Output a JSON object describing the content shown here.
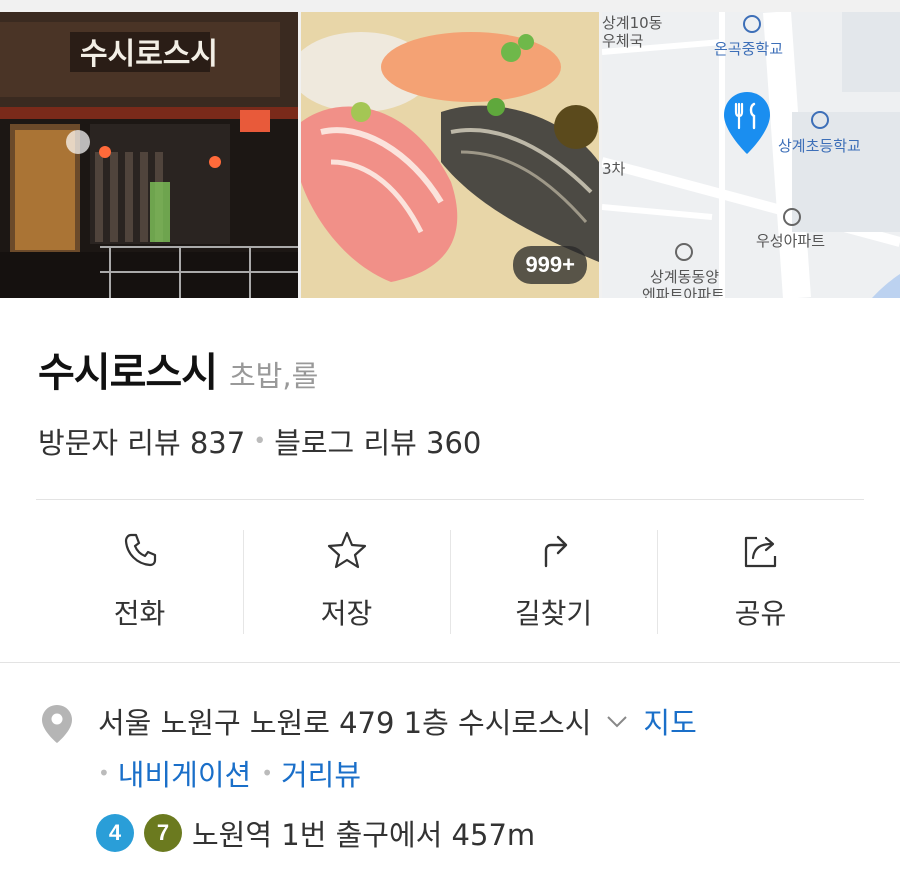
{
  "gallery": {
    "photo_count_badge": "999+",
    "map_labels": {
      "top_left_1": "상계10동",
      "top_left_2": "우체국",
      "school_1": "온곡중학교",
      "school_2": "상계초등학교",
      "left_3": "3차",
      "apt_1": "우성아파트",
      "apt_2_line1": "상계동동양",
      "apt_2_line2": "엔파트아파트"
    },
    "pin_color": "#1a8ef0"
  },
  "place": {
    "name": "수시로스시",
    "category": "초밥,롤",
    "visitor_review_label": "방문자 리뷰 837",
    "blog_review_label": "블로그 리뷰 360",
    "separator": "•"
  },
  "actions": [
    {
      "label": "전화",
      "icon": "phone-icon"
    },
    {
      "label": "저장",
      "icon": "star-icon"
    },
    {
      "label": "길찾기",
      "icon": "directions-icon"
    },
    {
      "label": "공유",
      "icon": "share-icon"
    }
  ],
  "address": {
    "full": "서울 노원구 노원로 479 1층 수시로스시",
    "map_link": "지도",
    "navigation_link": "내비게이션",
    "street_view_link": "거리뷰",
    "separator": "•"
  },
  "transit": {
    "lines": [
      {
        "number": "4",
        "color": "#2a9ed8"
      },
      {
        "number": "7",
        "color": "#6b7a1f"
      }
    ],
    "description": "노원역 1번 출구에서 457m"
  },
  "colors": {
    "link": "#1a6fc9",
    "text": "#333333",
    "muted": "#999999"
  }
}
